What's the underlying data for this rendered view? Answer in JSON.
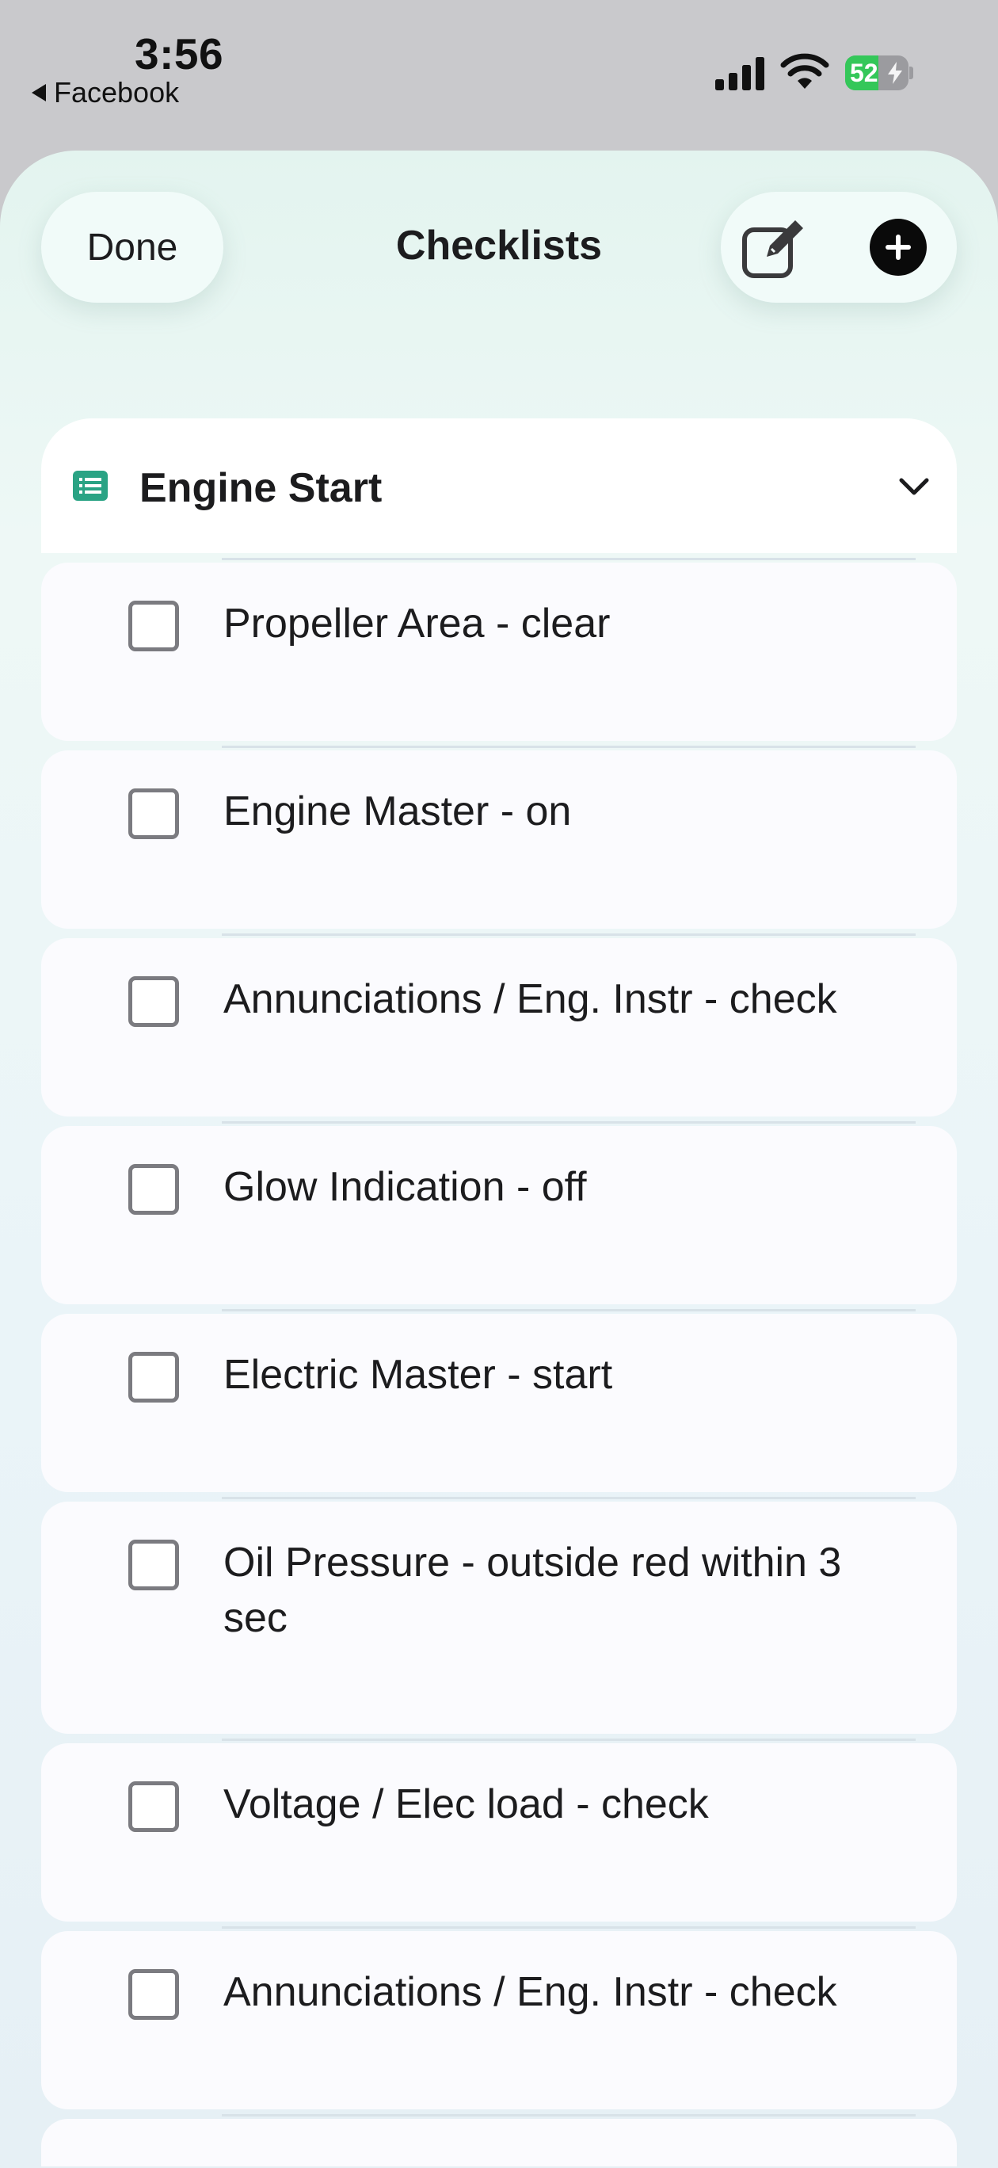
{
  "status_bar": {
    "time": "3:56",
    "back_app": "Facebook",
    "battery_percent": "52",
    "battery_level": 0.52,
    "charging": true
  },
  "nav": {
    "done_label": "Done",
    "title": "Checklists",
    "edit_icon": "square-and-pencil-icon",
    "add_icon": "plus-circle-icon"
  },
  "section": {
    "icon": "list-icon",
    "title": "Engine Start",
    "expanded": true,
    "accent_color": "#2aa384"
  },
  "items": [
    {
      "label": "Propeller Area - clear",
      "checked": false
    },
    {
      "label": "Engine Master - on",
      "checked": false
    },
    {
      "label": "Annunciations / Eng. Instr - check",
      "checked": false
    },
    {
      "label": "Glow Indication - off",
      "checked": false
    },
    {
      "label": "Electric Master - start",
      "checked": false
    },
    {
      "label": "Oil Pressure - outside red within 3 sec",
      "checked": false
    },
    {
      "label": "Voltage / Elec load - check",
      "checked": false
    },
    {
      "label": "Annunciations / Eng. Instr - check",
      "checked": false
    }
  ]
}
